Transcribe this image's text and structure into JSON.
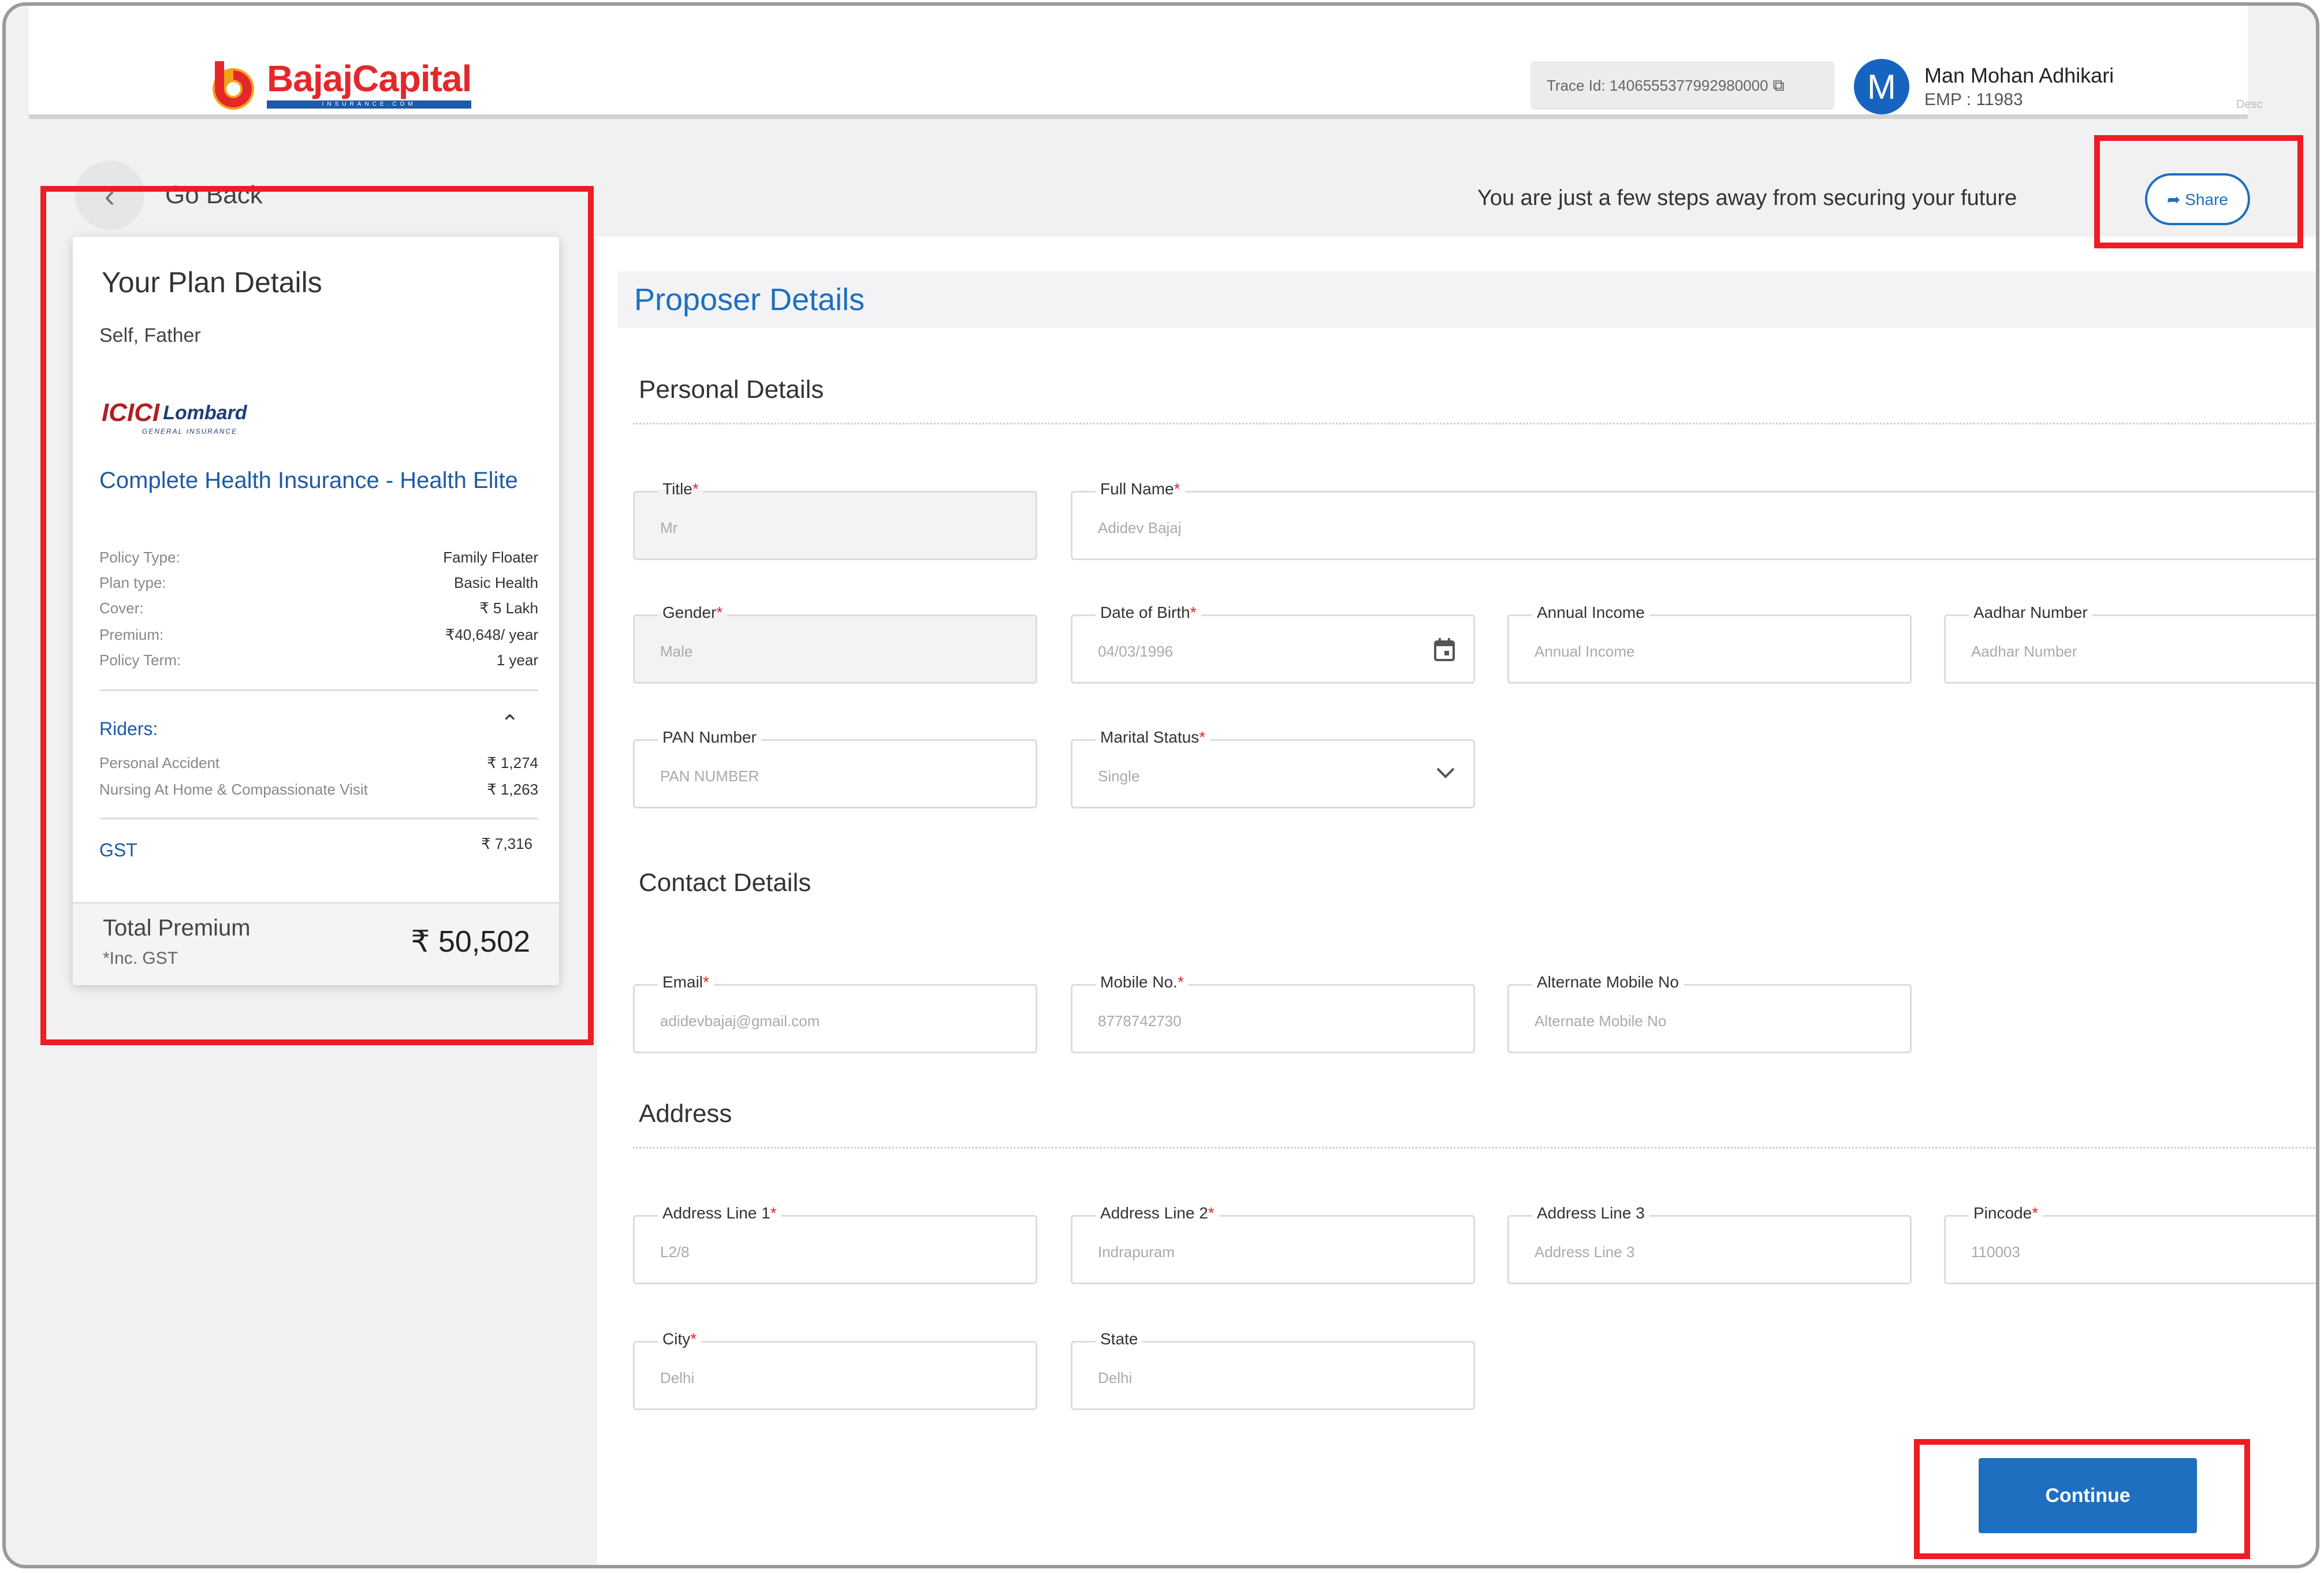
{
  "header": {
    "brand_name": "BajajCapital",
    "brand_tagline": "INSURANCE.COM",
    "trace_label": "Trace Id: 1406555377992980000",
    "user_initial": "M",
    "user_name": "Man Mohan Adhikari",
    "user_emp": "EMP : 11983",
    "right_hint": "Desc"
  },
  "nav": {
    "go_back": "Go Back",
    "steps_message": "You are just a few steps away from securing your future",
    "share_label": "➦ Share"
  },
  "plan": {
    "title": "Your Plan Details",
    "members": "Self, Father",
    "insurer_mark": "ICICI",
    "insurer_name": "Lombard",
    "insurer_sub": "GENERAL INSURANCE",
    "name": "Complete Health Insurance - Health Elite",
    "details": [
      {
        "label": "Policy Type:",
        "value": "Family Floater"
      },
      {
        "label": "Plan type:",
        "value": "Basic Health"
      },
      {
        "label": "Cover:",
        "value": "₹ 5 Lakh"
      },
      {
        "label": "Premium:",
        "value": "₹40,648/ year"
      },
      {
        "label": "Policy Term:",
        "value": "1 year"
      }
    ],
    "riders_label": "Riders:",
    "riders_chevron": "⌃",
    "riders": [
      {
        "label": "Personal Accident",
        "value": "₹ 1,274"
      },
      {
        "label": "Nursing At Home & Compassionate Visit",
        "value": "₹ 1,263"
      }
    ],
    "gst_label": "GST",
    "gst_value": "₹ 7,316",
    "total_label": "Total Premium",
    "total_sub": "*Inc. GST",
    "total_value": "₹ 50,502"
  },
  "form": {
    "title": "Proposer Details",
    "sections": {
      "personal": "Personal Details",
      "contact": "Contact Details",
      "address": "Address"
    },
    "fields": {
      "title": {
        "label": "Title",
        "value": "Mr"
      },
      "full_name": {
        "label": "Full Name",
        "value": "Adidev Bajaj"
      },
      "gender": {
        "label": "Gender",
        "value": "Male"
      },
      "dob": {
        "label": "Date of Birth",
        "value": "04/03/1996"
      },
      "annual_income": {
        "label": "Annual Income",
        "placeholder": "Annual Income"
      },
      "aadhar": {
        "label": "Aadhar Number",
        "placeholder": "Aadhar Number"
      },
      "pan": {
        "label": "PAN Number",
        "placeholder": "PAN NUMBER"
      },
      "marital": {
        "label": "Marital Status",
        "value": "Single"
      },
      "email": {
        "label": "Email",
        "value": "adidevbajaj@gmail.com"
      },
      "mobile": {
        "label": "Mobile No.",
        "value": "8778742730"
      },
      "alt_mobile": {
        "label": "Alternate Mobile No",
        "placeholder": "Alternate Mobile No"
      },
      "addr1": {
        "label": "Address Line 1",
        "value": "L2/8"
      },
      "addr2": {
        "label": "Address Line 2",
        "value": "Indrapuram"
      },
      "addr3": {
        "label": "Address Line 3",
        "placeholder": "Address Line 3"
      },
      "pincode": {
        "label": "Pincode",
        "value": "110003"
      },
      "city": {
        "label": "City",
        "value": "Delhi"
      },
      "state": {
        "label": "State",
        "value": "Delhi"
      }
    },
    "required_mark": "*",
    "continue_label": "Continue"
  },
  "icons": {
    "back": "‹",
    "calendar": "📅",
    "chevron_down": "⌄",
    "copy": "⧉"
  },
  "colors": {
    "brand_red": "#e4272b",
    "brand_blue": "#1e6fbf",
    "highlight": "#ee1d23"
  }
}
